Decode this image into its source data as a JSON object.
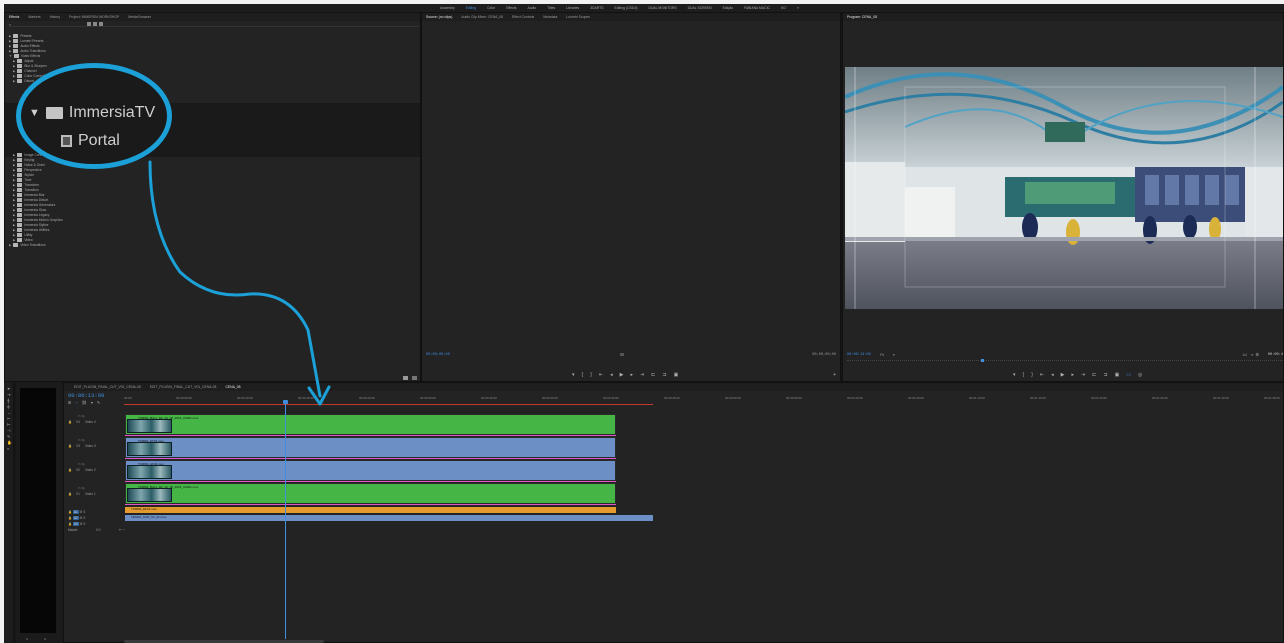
{
  "workspaces": [
    "Assembly",
    "Editing",
    "Color",
    "Effects",
    "Audio",
    "Titles",
    "Libraries",
    "3DARTS",
    "Editing (CS5.5)",
    "DUAL MONITORS",
    "DUAL SCREEN",
    "Edição",
    "FABIANA MACIC",
    "KO"
  ],
  "active_workspace_index": 1,
  "effects_panel": {
    "tabs": [
      "Effects",
      "Markers",
      "History",
      "Project: IMMERSIA WORKSHOP",
      "Media Browser"
    ],
    "tree_top": [
      "Presets",
      "Lumetri Presets",
      "Audio Effects",
      "Audio Transitions",
      "Video Effects",
      "Adjust",
      "Blur & Sharpen",
      "Channel",
      "Color Correction",
      "Distort"
    ],
    "zoom_folder": "ImmersiaTV",
    "zoom_item": "Portal",
    "tree_bottom": [
      "Image Control",
      "Keying",
      "Noise & Grain",
      "Perspective",
      "Stylize",
      "Time",
      "Transform",
      "Transition",
      "Immersia Blur",
      "Immersia Distort",
      "Immersia Generators",
      "Immersia Glow",
      "Immersia Legacy",
      "Immersia Motion Graphics",
      "Immersia Stylize",
      "Immersia Utilities",
      "Utility",
      "Video",
      "Video Transitions"
    ]
  },
  "source_monitor": {
    "tabs": [
      "Source: (no clips)",
      "Audio Clip Mixer: CENA_08",
      "Effect Controls",
      "Metadata",
      "Lumetri Scopes"
    ],
    "tc_left": "00;00;00;00",
    "tc_right": "00;00;00;00"
  },
  "program_monitor": {
    "tab": "Program: CENA_08",
    "tc": "00:00:13:09",
    "fit": "Fit",
    "scale": "1/4",
    "tc_right": "00:00:4"
  },
  "timeline": {
    "tabs": [
      "EDIT_PLUGIN_FINAL_CUT_V01_CENA-08",
      "EDIT_PLUGIN_FINAL_CUT_V01_CENA-08",
      "CENA_08"
    ],
    "timecode": "00:00:13:09",
    "ruler": [
      "00:00",
      "00:00:05:00",
      "00:00:10:00",
      "00:00:15:00",
      "00:00:20:00",
      "00:00:25:00",
      "00:00:30:00",
      "00:00:35:00",
      "00:00:40:00",
      "00:00:45:00",
      "00:00:50:00",
      "00:00:55:00",
      "00:01:00:00",
      "00:01:05:00",
      "00:01:10:00",
      "00:01:15:00",
      "00:01:20:00",
      "00:01:25:00",
      "00:01:30:00",
      "00:01:35:00"
    ],
    "tracks": [
      "Video 4",
      "Video 3",
      "Video 2",
      "Video 1"
    ],
    "audio_tracks": [
      "A1",
      "A2",
      "A3"
    ],
    "master": "Master",
    "master_val": "0.0",
    "clips": [
      "TORRE_BALL_EF_02_08_2016_C0001.mov",
      "TORRE_EF01.mov",
      "TORRE_EF02.mov",
      "TORRE_BALL_EF_02_08_2016_C0001.mov",
      "TORRE_EF01.mov",
      "TESSO_CLIP_V1_21.mov"
    ]
  },
  "colors": {
    "accent": "#3f8ee0",
    "annotation": "#1ba0d8",
    "clip_green": "#45b646",
    "clip_blue": "#6c8fc6",
    "clip_orange": "#e39b2f"
  }
}
